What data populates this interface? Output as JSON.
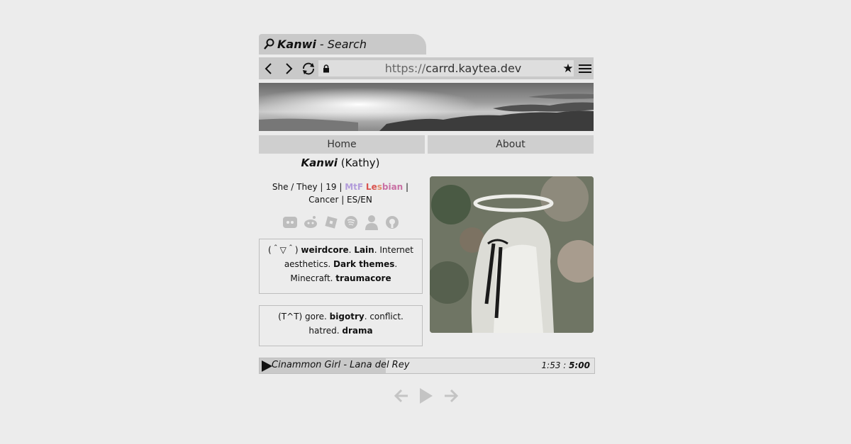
{
  "tab": {
    "brand": "Kanwi",
    "rest": "- Search"
  },
  "toolbar": {
    "url_scheme": "https://",
    "url_host": "carrd.kaytea.dev"
  },
  "nav": {
    "home": "Home",
    "about": "About"
  },
  "profile": {
    "name": "Kanwi",
    "alias": "(Kathy)",
    "pronouns_prefix": "She / They | 19 |",
    "mtf": "MtF",
    "les1": "Le",
    "les2": "s",
    "les3": "bian",
    "pronouns_suffix": "| Cancer | ES/EN"
  },
  "likes": {
    "kaomoji": "(＾▽＾)",
    "t1": "weirdcore",
    "t2": ". ",
    "t3": "Lain",
    "t4": ". Internet aesthetics. ",
    "t5": "Dark themes",
    "t6": ". Minecraft. ",
    "t7": "traumacore"
  },
  "dislikes": {
    "kaomoji": "(T^T)",
    "t1": " gore. ",
    "t2": "bigotry",
    "t3": ". conflict. hatred. ",
    "t4": "drama"
  },
  "player": {
    "track": "Cinammon Girl - Lana del Rey",
    "elapsed": "1:53",
    "sep": " : ",
    "total": "5:00",
    "progress": 0.377
  },
  "icons": [
    "search-icon",
    "back-icon",
    "forward-icon",
    "refresh-icon",
    "lock-icon",
    "star-icon",
    "menu-icon",
    "discord-icon",
    "reddit-icon",
    "roblox-icon",
    "spotify-icon",
    "user-icon",
    "github-icon",
    "play-icon",
    "prev-icon",
    "next-icon"
  ]
}
